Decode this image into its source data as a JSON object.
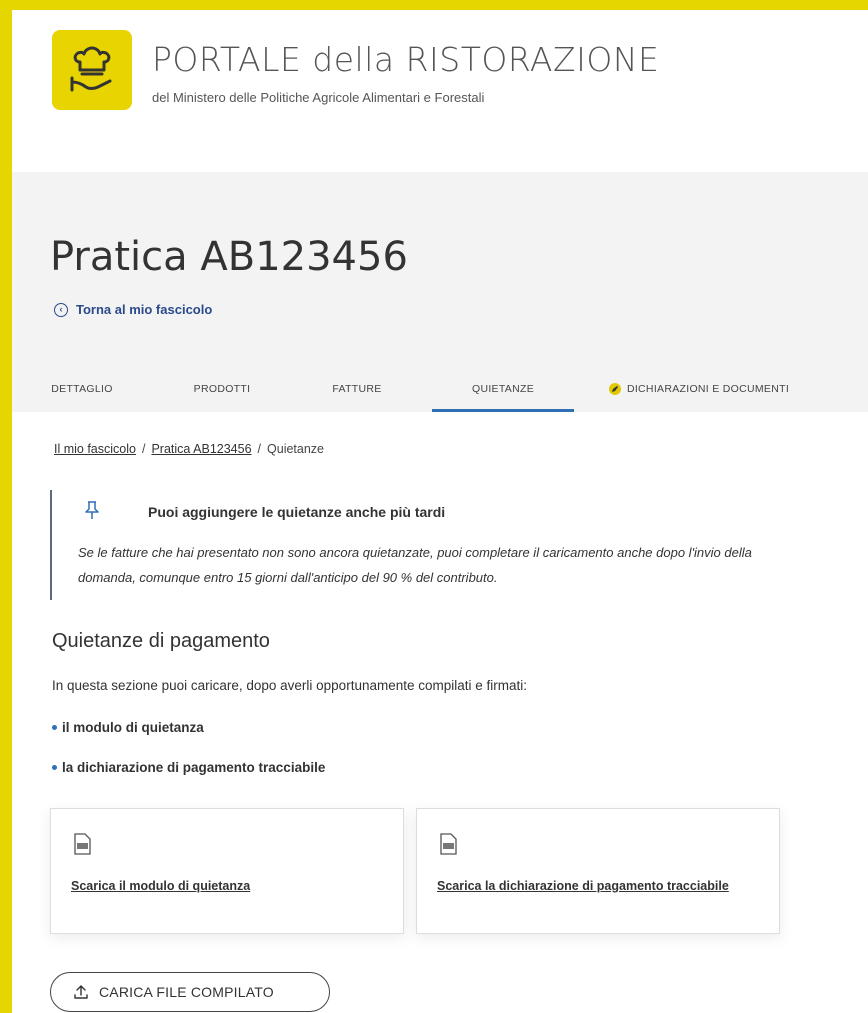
{
  "header": {
    "title": "PORTALE della RISTORAZIONE",
    "subtitle": "del Ministero delle Politiche Agricole Alimentari e Forestali"
  },
  "hero": {
    "page_title": "Pratica AB123456",
    "back_link": "Torna al mio fascicolo"
  },
  "tabs": [
    {
      "label": "DETTAGLIO"
    },
    {
      "label": "PRODOTTI"
    },
    {
      "label": "FATTURE"
    },
    {
      "label": "QUIETANZE"
    },
    {
      "label": "DICHIARAZIONI E DOCUMENTI"
    }
  ],
  "breadcrumb": {
    "item1": "Il mio fascicolo",
    "item2": "Pratica AB123456",
    "item3": "Quietanze",
    "sep": "/"
  },
  "callout": {
    "title": "Puoi aggiungere le quietanze anche più tardi",
    "text": "Se le fatture che hai presentato non sono ancora quietanzate, puoi completare il caricamento anche dopo l'invio della domanda, comunque entro 15 giorni dall'anticipo del 90 % del contributo."
  },
  "section": {
    "title": "Quietanze di pagamento",
    "intro": "In questa sezione puoi caricare, dopo averli opportunamente compilati e firmati:",
    "bullets": [
      "il modulo di quietanza",
      "la dichiarazione di pagamento tracciabile"
    ]
  },
  "cards": [
    {
      "link": "Scarica il modulo di quietanza"
    },
    {
      "link": "Scarica la dichiarazione di pagamento tracciabile"
    }
  ],
  "upload": {
    "label": "CARICA FILE COMPILATO"
  },
  "colors": {
    "accent_yellow": "#e8d400",
    "link_blue": "#2f6fb5",
    "hero_bg": "#f3f3f3"
  }
}
